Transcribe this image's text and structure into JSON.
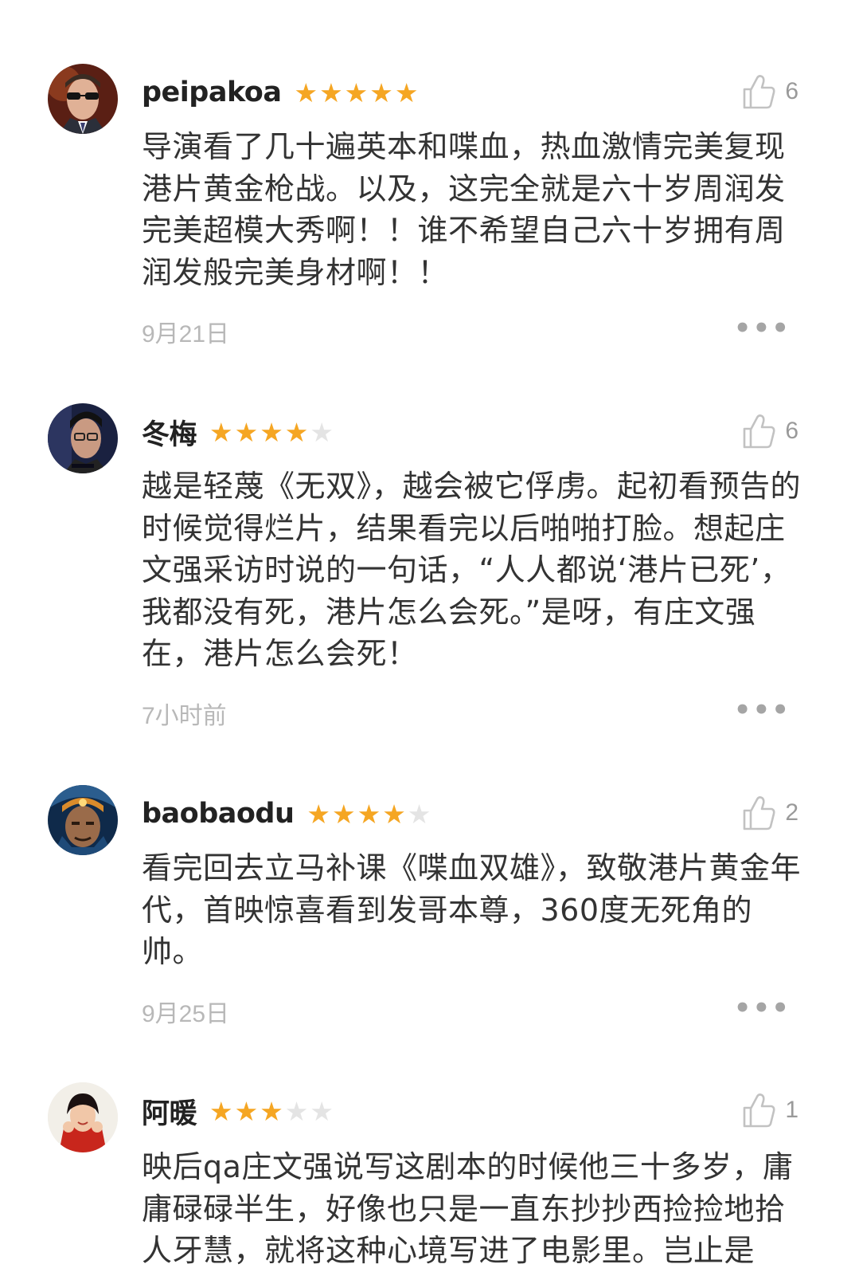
{
  "reviews": [
    {
      "username": "peipakoa",
      "rating": 5,
      "stars": [
        "★",
        "★",
        "★",
        "★",
        "★"
      ],
      "likes": "6",
      "content": "导演看了几十遍英本和喋血，热血激情完美复现港片黄金枪战。以及，这完全就是六十岁周润发完美超模大秀啊！！谁不希望自己六十岁拥有周润发般完美身材啊！！",
      "time": "9月21日",
      "more": "•••",
      "avatar_icon": "man-sunglasses-avatar"
    },
    {
      "username": "冬梅",
      "rating": 4,
      "stars": [
        "★",
        "★",
        "★",
        "★",
        "★"
      ],
      "likes": "6",
      "content": "越是轻蔑《无双》，越会被它俘虏。起初看预告的时候觉得烂片，结果看完以后啪啪打脸。想起庄文强采访时说的一句话，“人人都说‘港片已死’，我都没有死，港片怎么会死。”是呀，有庄文强在，港片怎么会死！",
      "time": "7小时前",
      "more": "•••",
      "avatar_icon": "man-glasses-avatar"
    },
    {
      "username": "baobaodu",
      "rating": 4,
      "stars": [
        "★",
        "★",
        "★",
        "★",
        "★"
      ],
      "likes": "2",
      "content": "看完回去立马补课《喋血双雄》，致敬港片黄金年代，首映惊喜看到发哥本尊，360度无死角的帅。",
      "time": "9月25日",
      "more": "•••",
      "avatar_icon": "space-marine-avatar"
    },
    {
      "username": "阿暖",
      "rating": 3,
      "stars": [
        "★",
        "★",
        "★",
        "★",
        "★"
      ],
      "likes": "1",
      "content": "映后qa庄文强说写这剧本的时候他三十多岁，庸庸碌碌半生，好像也只是一直东抄抄西捡捡地拾人牙慧，就将这种心境写进了电影里。岂止是",
      "time": "",
      "more": "",
      "avatar_icon": "girl-red-avatar"
    }
  ],
  "colors": {
    "star_on": "#f5a623",
    "star_off": "#e4e4e4",
    "meta_gray": "#b8b8b8",
    "text": "#333333"
  }
}
